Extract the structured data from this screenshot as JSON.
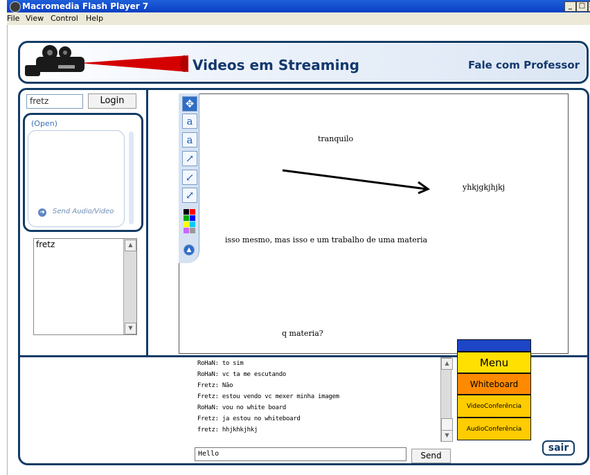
{
  "window": {
    "title": "Macromedia Flash Player 7"
  },
  "menubar": {
    "items": [
      "File",
      "View",
      "Control",
      "Help"
    ]
  },
  "header": {
    "title": "Videos em Streaming",
    "contact_link": "Fale com Professor"
  },
  "login": {
    "username_value": "fretz",
    "login_label": "Login"
  },
  "av_panel": {
    "status": "(Open)",
    "send_label": "Send Audio/Video"
  },
  "users": {
    "items": [
      "fretz"
    ]
  },
  "whiteboard": {
    "texts": [
      "tranquilo",
      "yhkjgkjhjkj",
      "isso mesmo, mas isso e um trabalho de uma materia",
      "q materia?"
    ],
    "palette_colors": [
      "#000000",
      "#ff0000",
      "#00aa00",
      "#0000ff",
      "#ffff00",
      "#00ccff",
      "#cc66ff",
      "#999999"
    ]
  },
  "chat": {
    "lines": [
      "RoHaN: to sim",
      "RoHaN: vc ta me escutando",
      "Fretz: Não",
      "Fretz: estou vendo vc mexer minha imagem",
      "RoHaN: vou no white board",
      "Fretz: ja estou no whiteboard",
      "fretz: hhjkhkjhkj"
    ],
    "input_value": "Hello",
    "send_label": "Send"
  },
  "menu": {
    "title": "Menu",
    "items": [
      "Whiteboard",
      "VideoConferência",
      "AudioConferência"
    ]
  },
  "exit_label": "sair"
}
